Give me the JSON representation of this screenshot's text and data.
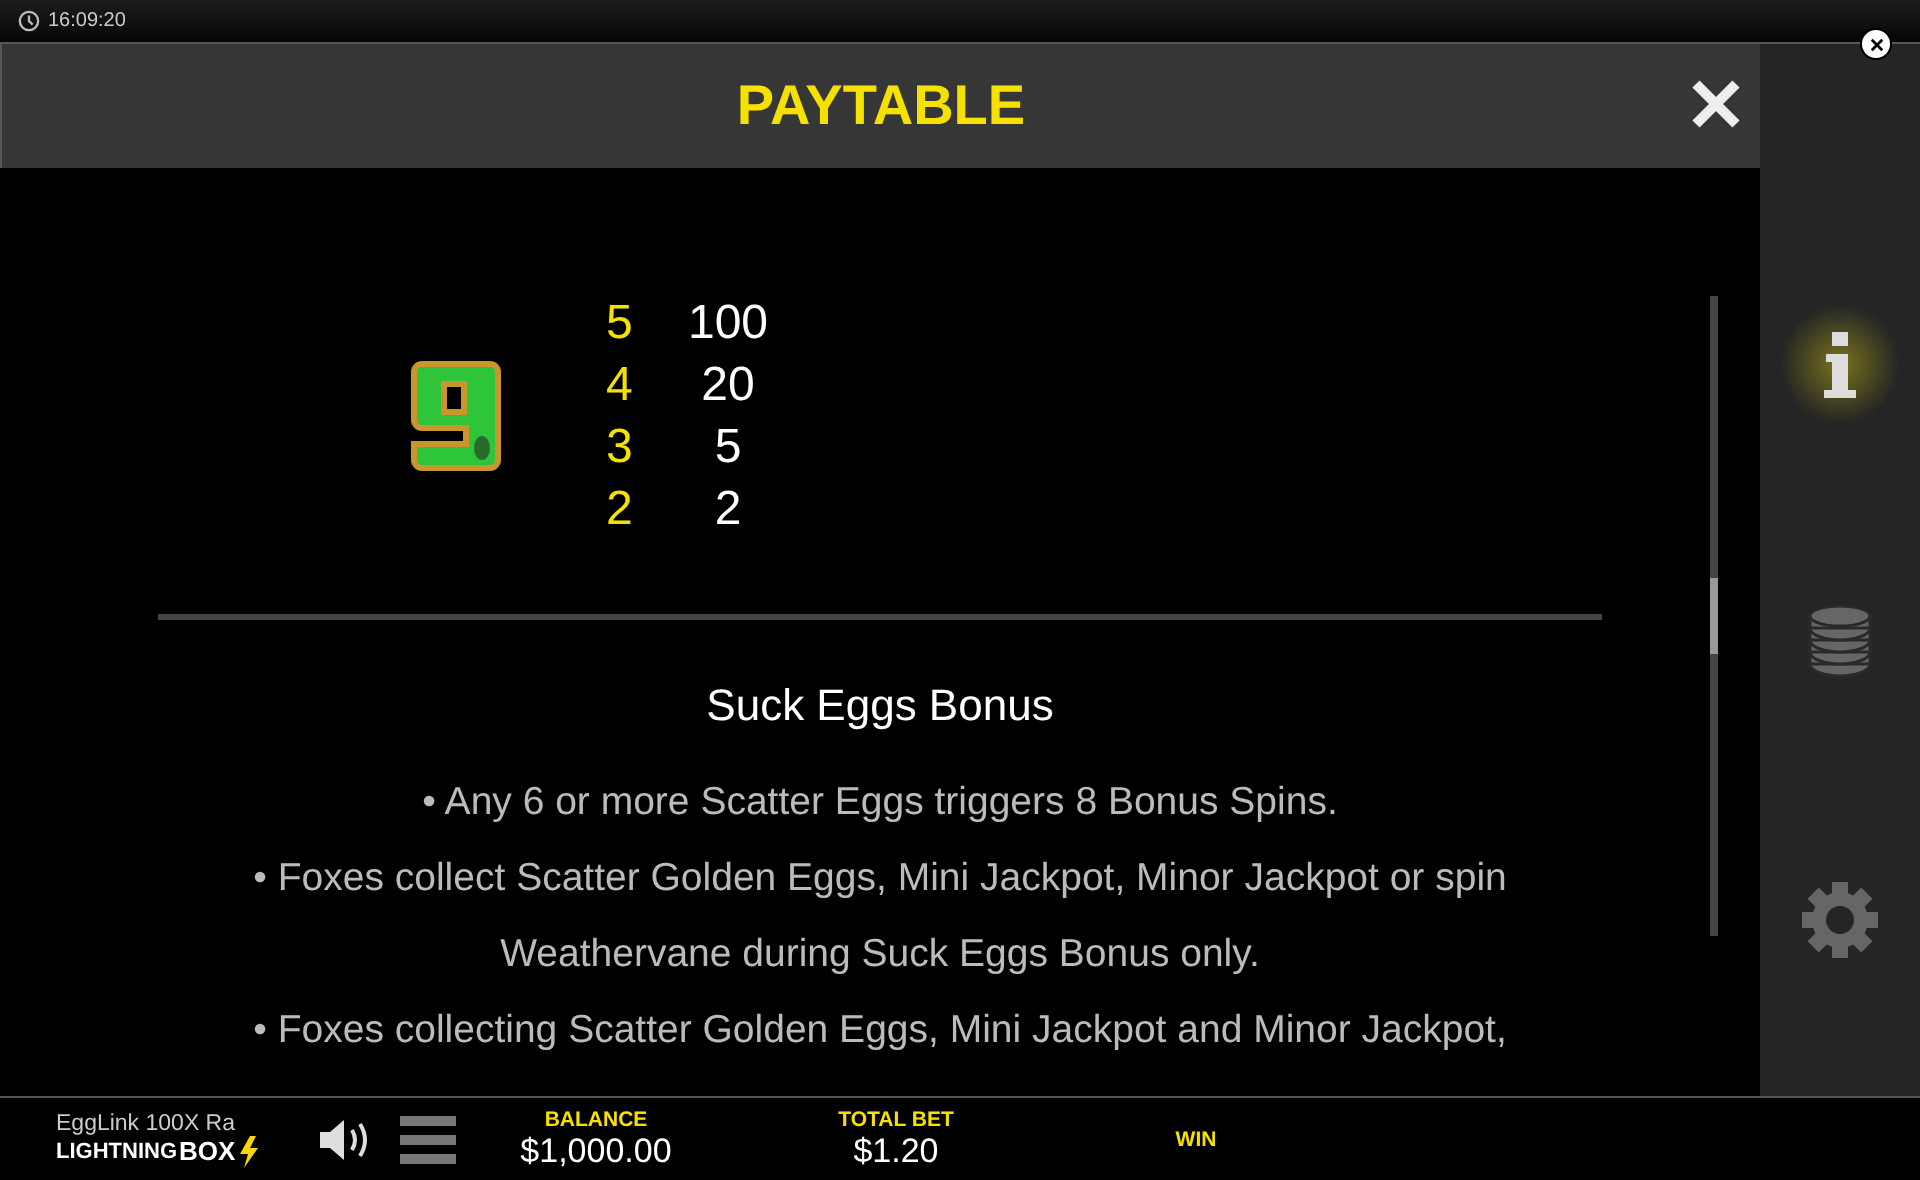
{
  "top_bar": {
    "time": "16:09:20"
  },
  "panel": {
    "title": "PAYTABLE"
  },
  "symbol": {
    "pays": [
      {
        "count": "5",
        "payout": "100"
      },
      {
        "count": "4",
        "payout": "20"
      },
      {
        "count": "3",
        "payout": "5"
      },
      {
        "count": "2",
        "payout": "2"
      }
    ]
  },
  "section": {
    "heading": "Suck Eggs Bonus",
    "lines": [
      "• Any 6 or more Scatter Eggs triggers 8 Bonus Spins.",
      "• Foxes collect Scatter Golden Eggs, Mini Jackpot, Minor Jackpot or spin Weathervane during Suck Eggs Bonus only.",
      "• Foxes collecting Scatter Golden Eggs, Mini Jackpot and Minor Jackpot,"
    ]
  },
  "sidebar": {
    "items": [
      {
        "kind": "info",
        "selected": true
      },
      {
        "kind": "coins",
        "selected": false
      },
      {
        "kind": "settings",
        "selected": false
      }
    ]
  },
  "bottom_bar": {
    "game_name": "EggLink 100X Ra",
    "logo_left": "LIGHTNING",
    "logo_right": "BOX",
    "stats": [
      {
        "label": "BALANCE",
        "value": "$1,000.00"
      },
      {
        "label": "TOTAL BET",
        "value": "$1.20"
      },
      {
        "label": "WIN"
      }
    ]
  }
}
